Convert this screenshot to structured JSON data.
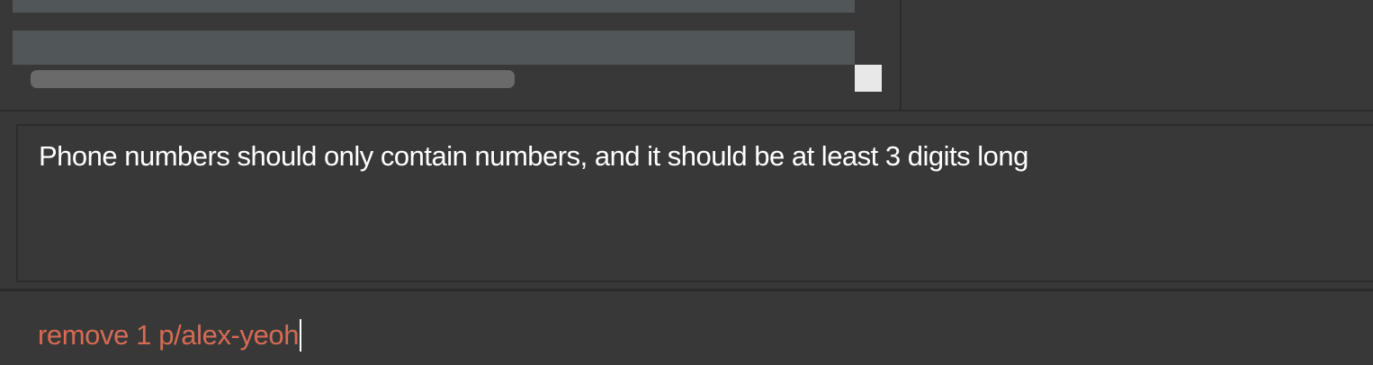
{
  "result_display": {
    "message": "Phone numbers should only contain numbers, and it should be at least 3 digits long"
  },
  "command_box": {
    "value": "remove 1 p/alex-yeoh"
  },
  "colors": {
    "background": "#383838",
    "list_row": "#515658",
    "error_text": "#d66b54",
    "result_text": "#ffffff"
  }
}
